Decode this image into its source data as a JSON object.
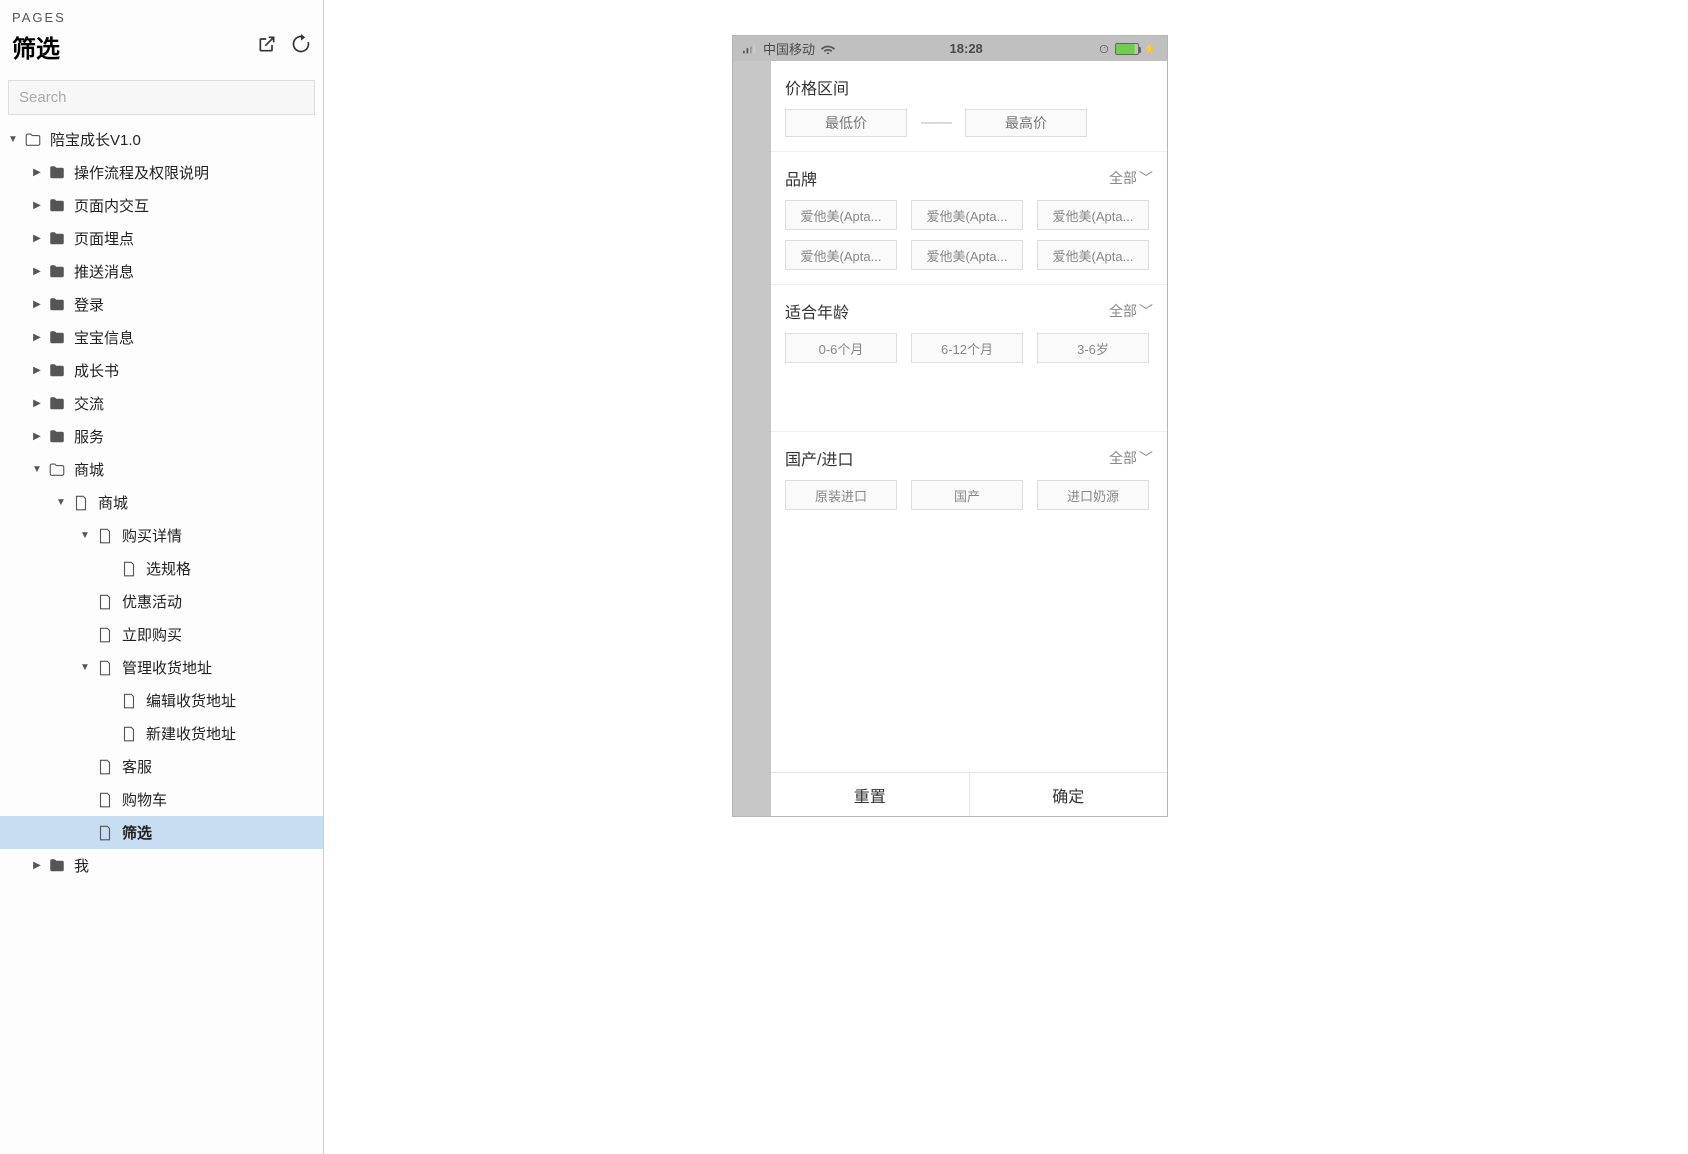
{
  "sidebar": {
    "pages_label": "PAGES",
    "title": "筛选",
    "search_placeholder": "Search",
    "tree": [
      {
        "depth": 0,
        "toggle": "down",
        "icon": "folder-open",
        "label": "陪宝成长V1.0"
      },
      {
        "depth": 1,
        "toggle": "right",
        "icon": "folder",
        "label": "操作流程及权限说明"
      },
      {
        "depth": 1,
        "toggle": "right",
        "icon": "folder",
        "label": "页面内交互"
      },
      {
        "depth": 1,
        "toggle": "right",
        "icon": "folder",
        "label": "页面埋点"
      },
      {
        "depth": 1,
        "toggle": "right",
        "icon": "folder",
        "label": "推送消息"
      },
      {
        "depth": 1,
        "toggle": "right",
        "icon": "folder",
        "label": "登录"
      },
      {
        "depth": 1,
        "toggle": "right",
        "icon": "folder",
        "label": "宝宝信息"
      },
      {
        "depth": 1,
        "toggle": "right",
        "icon": "folder",
        "label": "成长书"
      },
      {
        "depth": 1,
        "toggle": "right",
        "icon": "folder",
        "label": "交流"
      },
      {
        "depth": 1,
        "toggle": "right",
        "icon": "folder",
        "label": "服务"
      },
      {
        "depth": 1,
        "toggle": "down",
        "icon": "folder-open",
        "label": "商城"
      },
      {
        "depth": 2,
        "toggle": "down",
        "icon": "page",
        "label": "商城"
      },
      {
        "depth": 3,
        "toggle": "down",
        "icon": "page",
        "label": "购买详情"
      },
      {
        "depth": 4,
        "toggle": "",
        "icon": "page",
        "label": "选规格"
      },
      {
        "depth": 3,
        "toggle": "",
        "icon": "page",
        "label": "优惠活动"
      },
      {
        "depth": 3,
        "toggle": "",
        "icon": "page",
        "label": "立即购买"
      },
      {
        "depth": 3,
        "toggle": "down",
        "icon": "page",
        "label": "管理收货地址"
      },
      {
        "depth": 4,
        "toggle": "",
        "icon": "page",
        "label": "编辑收货地址"
      },
      {
        "depth": 4,
        "toggle": "",
        "icon": "page",
        "label": "新建收货地址"
      },
      {
        "depth": 3,
        "toggle": "",
        "icon": "page",
        "label": "客服"
      },
      {
        "depth": 3,
        "toggle": "",
        "icon": "page",
        "label": "购物车"
      },
      {
        "depth": 3,
        "toggle": "",
        "icon": "page",
        "label": "筛选",
        "selected": true
      },
      {
        "depth": 1,
        "toggle": "right",
        "icon": "folder",
        "label": "我"
      }
    ]
  },
  "device": {
    "statusbar": {
      "carrier": "中国移动",
      "time": "18:28"
    },
    "panel": {
      "price": {
        "title": "价格区间",
        "min_placeholder": "最低价",
        "max_placeholder": "最高价"
      },
      "brand": {
        "title": "品牌",
        "all": "全部",
        "chips": [
          "爱他美(Apta...",
          "爱他美(Apta...",
          "爱他美(Apta...",
          "爱他美(Apta...",
          "爱他美(Apta...",
          "爱他美(Apta..."
        ]
      },
      "age": {
        "title": "适合年龄",
        "all": "全部",
        "chips": [
          "0-6个月",
          "6-12个月",
          "3-6岁"
        ]
      },
      "origin": {
        "title": "国产/进口",
        "all": "全部",
        "chips": [
          "原装进口",
          "国产",
          "进口奶源"
        ]
      },
      "reset": "重置",
      "confirm": "确定"
    }
  }
}
